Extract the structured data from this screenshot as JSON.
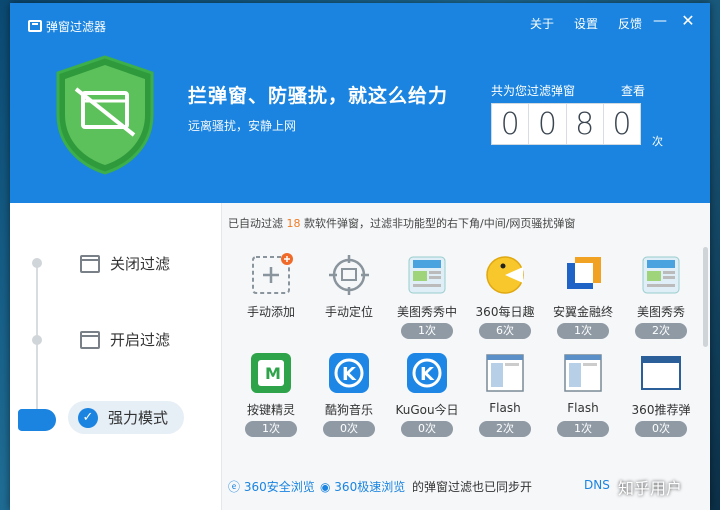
{
  "window": {
    "title": "弹窗过滤器",
    "links": [
      "关于",
      "设置",
      "反馈"
    ],
    "minimize": "—",
    "close": "✕"
  },
  "header": {
    "slogan": "拦弹窗、防骚扰，就这么给力",
    "subslogan": "远离骚扰，安静上网",
    "counter_label": "共为您过滤弹窗",
    "counter_view": "查看",
    "digits": [
      "0",
      "0",
      "8",
      "0"
    ],
    "counter_unit": "次"
  },
  "sidebar": {
    "items": [
      {
        "label": "关闭过滤"
      },
      {
        "label": "开启过滤"
      },
      {
        "label": "强力模式"
      }
    ]
  },
  "content": {
    "info_prefix": "已自动过滤 ",
    "info_count": "18",
    "info_suffix": " 款软件弹窗，过滤非功能型的右下角/中间/网页骚扰弹窗",
    "items": [
      {
        "label": "手动添加",
        "count": ""
      },
      {
        "label": "手动定位",
        "count": ""
      },
      {
        "label": "美图秀秀中",
        "count": "1次"
      },
      {
        "label": "360每日趣",
        "count": "6次"
      },
      {
        "label": "安翼金融终",
        "count": "1次"
      },
      {
        "label": "美图秀秀",
        "count": "2次"
      },
      {
        "label": "按键精灵",
        "count": "1次"
      },
      {
        "label": "酷狗音乐",
        "count": "0次"
      },
      {
        "label": "KuGou今日",
        "count": "0次"
      },
      {
        "label": "Flash",
        "count": "2次"
      },
      {
        "label": "Flash",
        "count": "1次"
      },
      {
        "label": "360推荐弹",
        "count": "0次"
      }
    ]
  },
  "footer": {
    "browser1": "360安全浏览",
    "browser2": "360极速浏览",
    "sync_text": "的弹窗过滤也已同步开",
    "dns": "DNS",
    "watermark": "知乎用户"
  },
  "colors": {
    "header_blue": "#1a84e0",
    "counter_accent": "#f07c24",
    "pill_gray": "#8f9aa4"
  }
}
